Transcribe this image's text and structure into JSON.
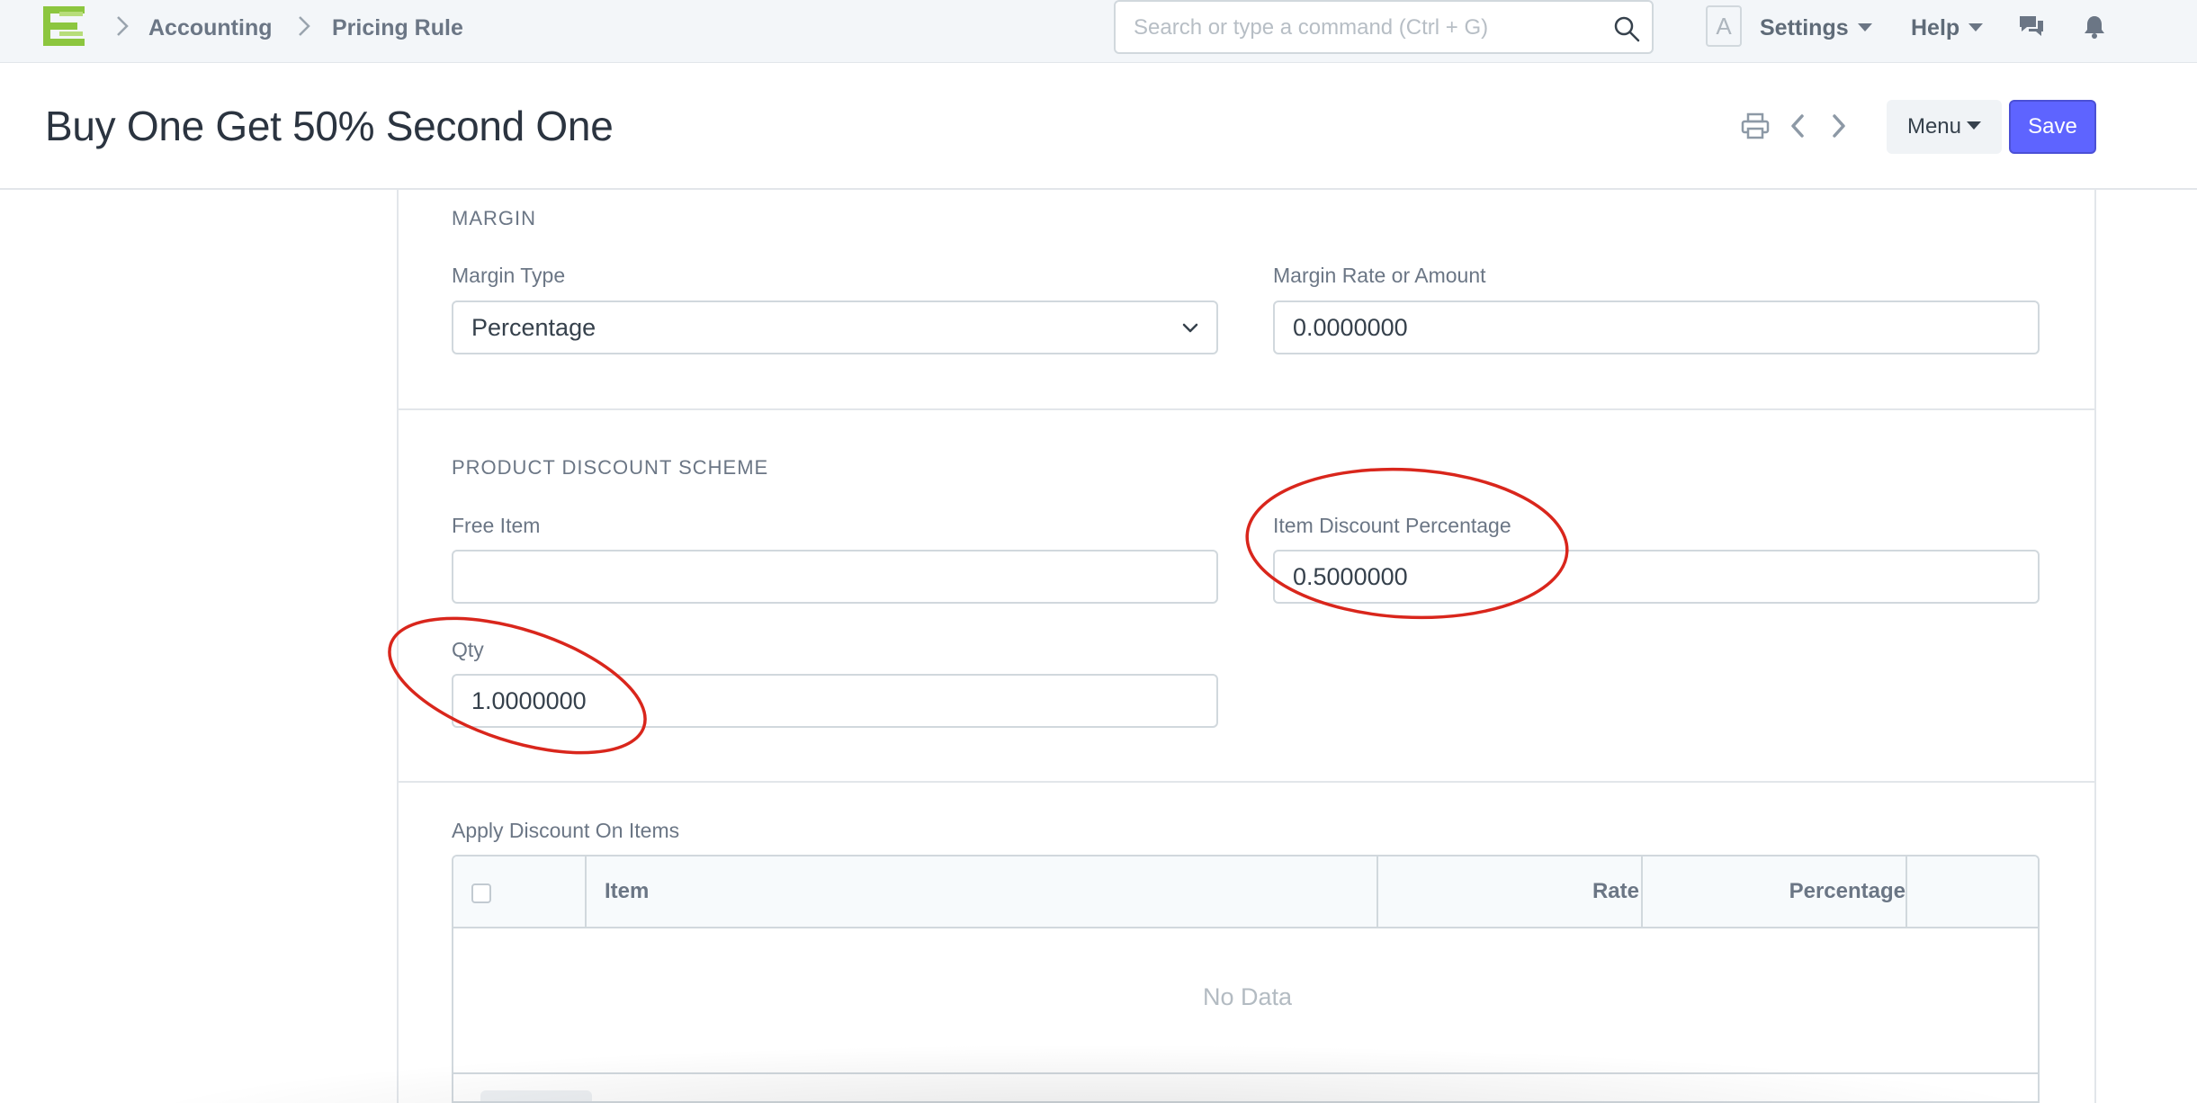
{
  "navbar": {
    "logo_icon": "erpnext-logo-icon",
    "breadcrumbs": [
      "Accounting",
      "Pricing Rule"
    ],
    "search_placeholder": "Search or type a command (Ctrl + G)",
    "avatar_letter": "A",
    "settings_label": "Settings",
    "help_label": "Help",
    "icons": [
      "chat-icon",
      "bell-icon"
    ]
  },
  "page": {
    "title": "Buy One Get 50% Second One",
    "menu_label": "Menu",
    "save_label": "Save",
    "header_icons": [
      "print-icon",
      "chevron-left-icon",
      "chevron-right-icon"
    ]
  },
  "margin_section": {
    "title": "MARGIN",
    "margin_type_label": "Margin Type",
    "margin_type_value": "Percentage",
    "margin_rate_label": "Margin Rate or Amount",
    "margin_rate_value": "0.0000000"
  },
  "product_discount_section": {
    "title": "PRODUCT DISCOUNT SCHEME",
    "free_item_label": "Free Item",
    "free_item_value": "",
    "item_discount_label": "Item Discount Percentage",
    "item_discount_value": "0.5000000",
    "qty_label": "Qty",
    "qty_value": "1.0000000"
  },
  "apply_discount": {
    "label": "Apply Discount On Items",
    "columns": [
      "Item",
      "Rate",
      "Percentage"
    ],
    "empty_text": "No Data"
  },
  "colors": {
    "primary": "#5e64ff",
    "annotation": "#d9261c",
    "logo_green": "#8cc63f"
  }
}
